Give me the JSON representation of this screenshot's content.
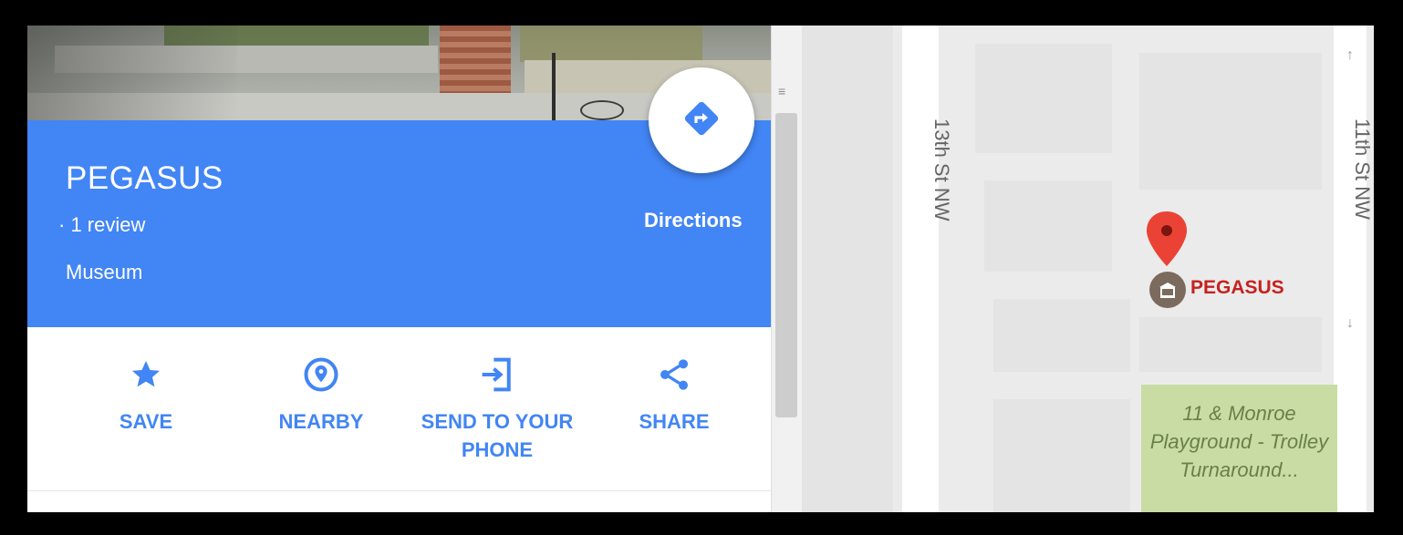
{
  "place": {
    "title": "PEGASUS",
    "review": "· 1 review",
    "category": "Museum",
    "directions_label": "Directions"
  },
  "colors": {
    "header_blue": "#4285f4",
    "accent": "#4285f4",
    "pin_red": "#ea4335",
    "park_green": "#c9dca3"
  },
  "actions": [
    {
      "label": "SAVE",
      "icon": "star-icon"
    },
    {
      "label": "NEARBY",
      "icon": "nearby-icon"
    },
    {
      "label": "SEND TO YOUR PHONE",
      "icon": "send-to-phone-icon"
    },
    {
      "label": "SHARE",
      "icon": "share-icon"
    }
  ],
  "map": {
    "street_left": "13th St NW",
    "street_right": "11th St NW",
    "poi_label": "PEGASUS",
    "park_label": "11 & Monroe Playground - Trolley Turnaround..."
  }
}
